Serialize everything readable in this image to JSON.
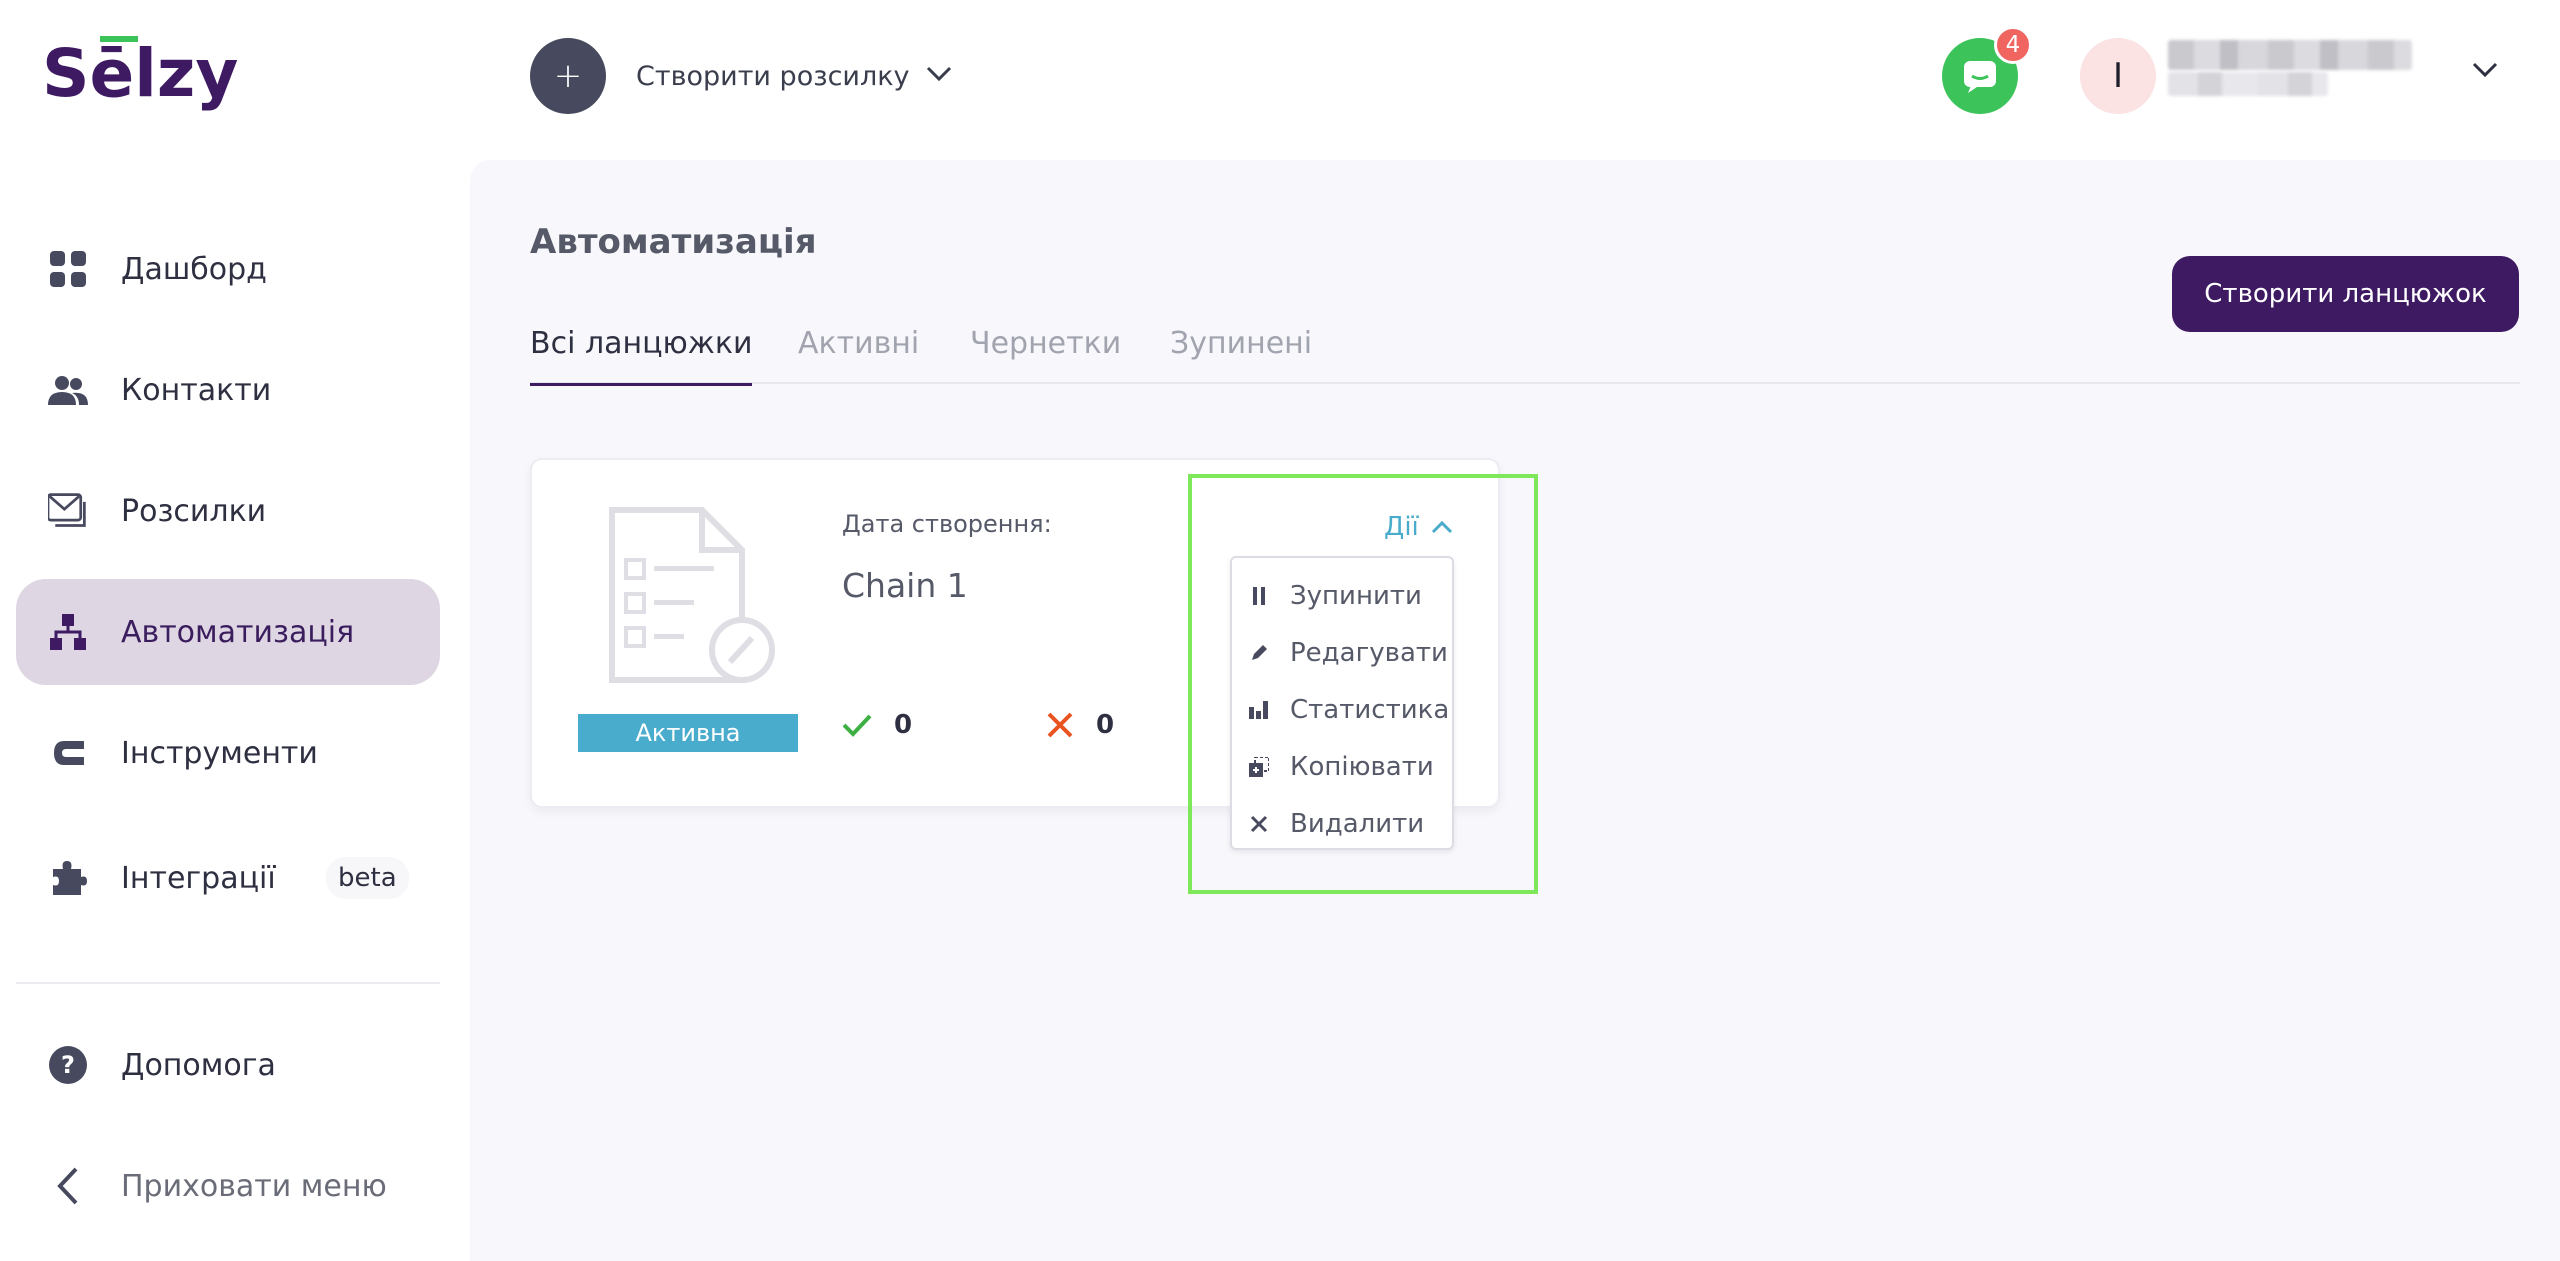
{
  "brand": {
    "logo_text": "Selzy",
    "logo_color": "#3e1a63",
    "accent_line": "#3cc35a"
  },
  "header": {
    "create_mailing_label": "Створити розсилку",
    "notification_count": "4",
    "avatar_initial": "І"
  },
  "sidebar": {
    "items": [
      {
        "label": "Дашборд",
        "icon": "dashboard-icon"
      },
      {
        "label": "Контакти",
        "icon": "contacts-icon"
      },
      {
        "label": "Розсилки",
        "icon": "mailings-icon"
      },
      {
        "label": "Автоматизація",
        "icon": "automation-icon",
        "active": true
      },
      {
        "label": "Інструменти",
        "icon": "tools-icon"
      },
      {
        "label": "Інтеграції",
        "icon": "integrations-icon",
        "badge": "beta"
      }
    ],
    "help_label": "Допомога",
    "hide_menu_label": "Приховати меню"
  },
  "main": {
    "title": "Автоматизація",
    "create_chain_label": "Створити ланцюжок",
    "tabs": [
      {
        "label": "Всі ланцюжки",
        "active": true
      },
      {
        "label": "Активні"
      },
      {
        "label": "Чернетки"
      },
      {
        "label": "Зупинені"
      }
    ],
    "card": {
      "date_label": "Дата створення:",
      "name": "Chain 1",
      "status": "Активна",
      "success_count": "0",
      "fail_count": "0",
      "actions_label": "Дії",
      "menu": [
        {
          "label": "Зупинити",
          "icon": "pause-icon"
        },
        {
          "label": "Редагувати",
          "icon": "pencil-icon"
        },
        {
          "label": "Статистика",
          "icon": "stats-icon"
        },
        {
          "label": "Копіювати",
          "icon": "copy-icon"
        },
        {
          "label": "Видалити",
          "icon": "close-icon"
        }
      ]
    }
  }
}
